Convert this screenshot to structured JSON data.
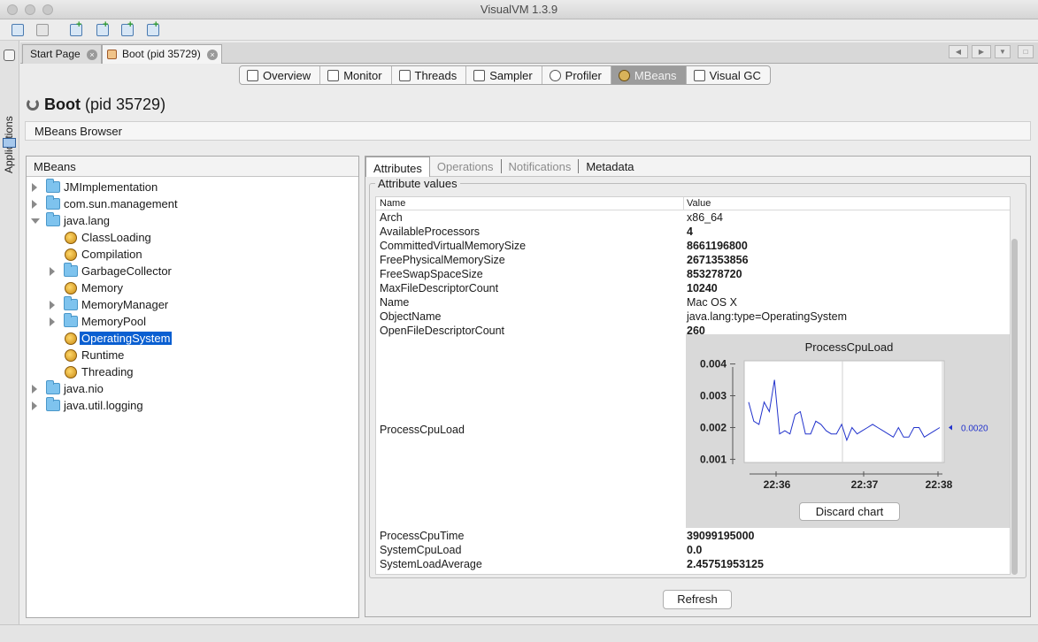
{
  "window": {
    "title": "VisualVM 1.3.9"
  },
  "sidebar": {
    "label": "Applications"
  },
  "doc_tabs": [
    {
      "label": "Start Page"
    },
    {
      "label": "Boot (pid 35729)"
    }
  ],
  "view_tabs": [
    {
      "label": "Overview",
      "icon": "overview-icon"
    },
    {
      "label": "Monitor",
      "icon": "monitor-icon"
    },
    {
      "label": "Threads",
      "icon": "threads-icon"
    },
    {
      "label": "Sampler",
      "icon": "sampler-icon"
    },
    {
      "label": "Profiler",
      "icon": "profiler-icon"
    },
    {
      "label": "MBeans",
      "icon": "mbeans-icon"
    },
    {
      "label": "Visual GC",
      "icon": "visual-gc-icon"
    }
  ],
  "page": {
    "title_bold": "Boot",
    "title_rest": "(pid 35729)",
    "section": "MBeans Browser"
  },
  "tree": {
    "header": "MBeans",
    "items": [
      {
        "label": "JMImplementation"
      },
      {
        "label": "com.sun.management"
      },
      {
        "label": "java.lang"
      },
      {
        "label": "ClassLoading"
      },
      {
        "label": "Compilation"
      },
      {
        "label": "GarbageCollector"
      },
      {
        "label": "Memory"
      },
      {
        "label": "MemoryManager"
      },
      {
        "label": "MemoryPool"
      },
      {
        "label": "OperatingSystem"
      },
      {
        "label": "Runtime"
      },
      {
        "label": "Threading"
      },
      {
        "label": "java.nio"
      },
      {
        "label": "java.util.logging"
      }
    ],
    "selected": "OperatingSystem"
  },
  "sub_tabs": [
    {
      "label": "Attributes"
    },
    {
      "label": "Operations"
    },
    {
      "label": "Notifications"
    },
    {
      "label": "Metadata"
    }
  ],
  "attributes": {
    "group_title": "Attribute values",
    "col_name": "Name",
    "col_value": "Value",
    "rows": [
      {
        "name": "Arch",
        "value": "x86_64"
      },
      {
        "name": "AvailableProcessors",
        "value": "4"
      },
      {
        "name": "CommittedVirtualMemorySize",
        "value": "8661196800"
      },
      {
        "name": "FreePhysicalMemorySize",
        "value": "2671353856"
      },
      {
        "name": "FreeSwapSpaceSize",
        "value": "853278720"
      },
      {
        "name": "MaxFileDescriptorCount",
        "value": "10240"
      },
      {
        "name": "Name",
        "value": "Mac OS X"
      },
      {
        "name": "ObjectName",
        "value": "java.lang:type=OperatingSystem"
      },
      {
        "name": "OpenFileDescriptorCount",
        "value": "260"
      }
    ],
    "chart_row_name": "ProcessCpuLoad",
    "rows_after": [
      {
        "name": "ProcessCpuTime",
        "value": "39099195000"
      },
      {
        "name": "SystemCpuLoad",
        "value": "0.0"
      },
      {
        "name": "SystemLoadAverage",
        "value": "2.45751953125"
      }
    ]
  },
  "chart_data": {
    "type": "line",
    "title": "ProcessCpuLoad",
    "xlabel": "",
    "ylabel": "",
    "ylim": [
      0.0009,
      0.0041
    ],
    "y_ticks": [
      "0.004",
      "0.003",
      "0.002",
      "0.001"
    ],
    "x_ticks": [
      "22:36",
      "22:37",
      "22:38"
    ],
    "current_value_label": "0.0020",
    "series": [
      {
        "values": [
          0.0028,
          0.0022,
          0.0021,
          0.0028,
          0.0025,
          0.0035,
          0.0018,
          0.0019,
          0.0018,
          0.0024,
          0.0025,
          0.0018,
          0.0018,
          0.0022,
          0.0021,
          0.0019,
          0.0018,
          0.0018,
          0.0021,
          0.0016,
          0.002,
          0.0018,
          0.0019,
          0.002,
          0.0021,
          0.002,
          0.0019,
          0.0018,
          0.0017,
          0.002,
          0.0017,
          0.0017,
          0.002,
          0.002,
          0.0017,
          0.0018,
          0.0019,
          0.002
        ]
      }
    ],
    "grid": true,
    "line_color": "#2233cc"
  },
  "buttons": {
    "discard_chart": "Discard chart",
    "refresh": "Refresh"
  }
}
